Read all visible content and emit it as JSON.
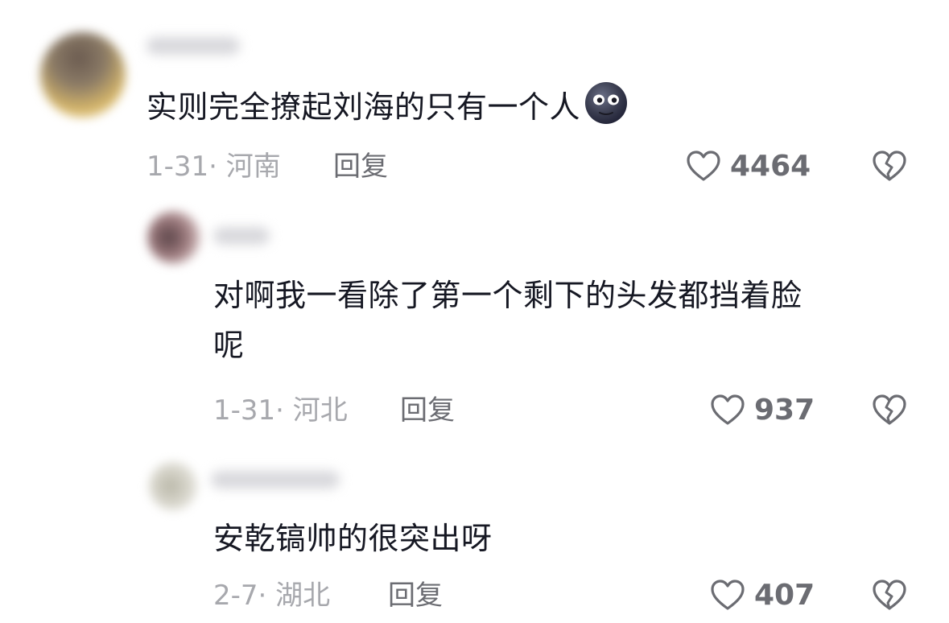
{
  "comments": [
    {
      "text": "实则完全撩起刘海的只有一个人",
      "emoji": "new-moon-face",
      "date": "1-31",
      "sep": "·",
      "location": "河南",
      "reply_label": "回复",
      "likes": "4464"
    },
    {
      "text_line1": "对啊我一看除了第一个剩下的头发都挡着脸",
      "text_line2": "呢",
      "date": "1-31",
      "sep": "·",
      "location": "河北",
      "reply_label": "回复",
      "likes": "937"
    },
    {
      "text": "安乾镐帅的很突出呀",
      "date": "2-7",
      "sep": "·",
      "location": "湖北",
      "reply_label": "回复",
      "likes": "407"
    }
  ],
  "colors": {
    "text": "#161823",
    "meta": "#a7a8ad",
    "action": "#6b6c72"
  },
  "icons": [
    "heart-outline-icon",
    "broken-heart-icon",
    "new-moon-face-emoji"
  ]
}
